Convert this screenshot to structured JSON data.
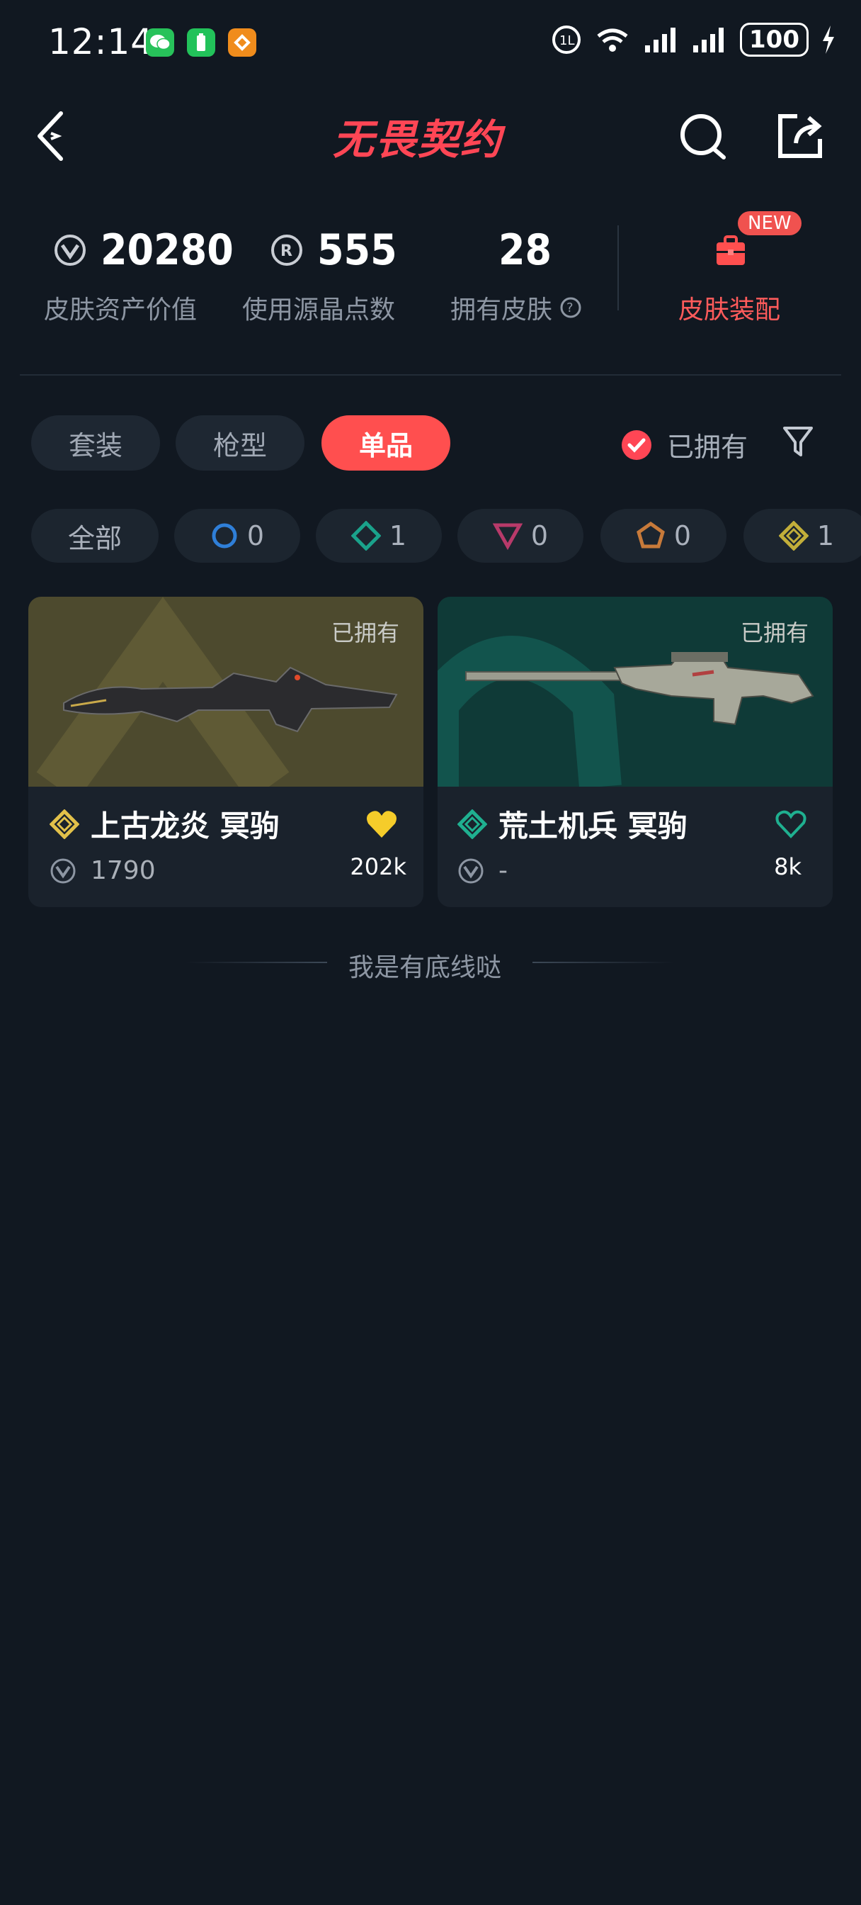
{
  "status_bar": {
    "time": "12:14",
    "battery": "100"
  },
  "header": {
    "title": "无畏契约"
  },
  "stats": {
    "asset_value": "20280",
    "asset_value_label": "皮肤资产价值",
    "radianite_points": "555",
    "radianite_label": "使用源晶点数",
    "owned_skins": "28",
    "owned_skins_label": "拥有皮肤",
    "equip_label": "皮肤装配",
    "equip_badge": "NEW"
  },
  "tabs": [
    {
      "label": "套装"
    },
    {
      "label": "枪型"
    },
    {
      "label": "单品"
    }
  ],
  "owned_filter": {
    "label": "已拥有"
  },
  "tier_chips": [
    {
      "label": "全部"
    },
    {
      "count": "0",
      "color": "#2f7fd8"
    },
    {
      "count": "1",
      "color": "#1aa28b"
    },
    {
      "count": "0",
      "color": "#b83a6a"
    },
    {
      "count": "0",
      "color": "#c77a3a"
    },
    {
      "count": "1",
      "color": "#c2ae3a"
    }
  ],
  "cards": [
    {
      "owned": "已拥有",
      "name": "上古龙炎 冥驹",
      "price": "1790",
      "likes": "202k",
      "tier_color": "#e2c14a",
      "liked": true
    },
    {
      "owned": "已拥有",
      "name": "荒土机兵 冥驹",
      "price": "-",
      "likes": "8k",
      "tier_color": "#1fb090",
      "liked": false
    }
  ],
  "footer": {
    "text": "我是有底线哒"
  }
}
